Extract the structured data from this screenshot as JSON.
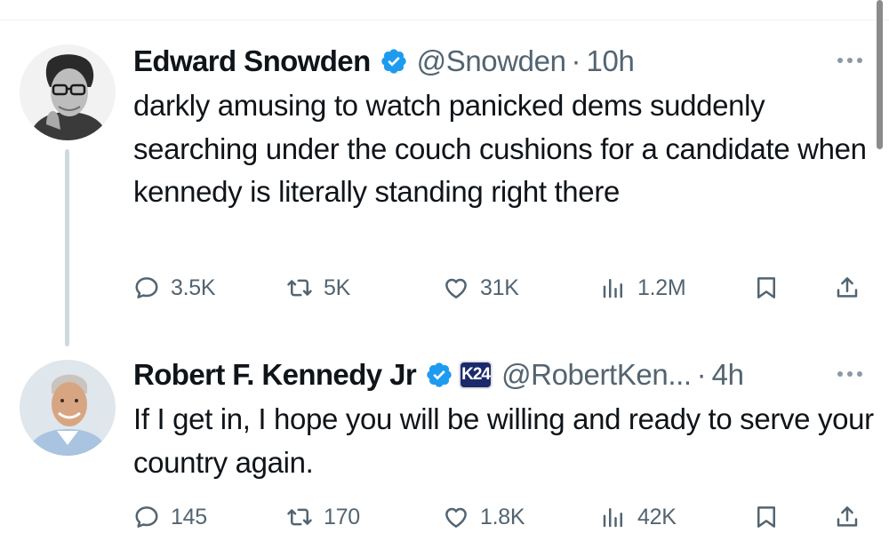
{
  "tweets": [
    {
      "name": "Edward Snowden",
      "handle": "@Snowden",
      "time": "10h",
      "text": "darkly amusing to watch panicked dems suddenly searching under the couch cushions for a candidate when kennedy is literally standing right there",
      "stats": {
        "replies": "3.5K",
        "reposts": "5K",
        "likes": "31K",
        "views": "1.2M"
      }
    },
    {
      "name": "Robert F. Kennedy Jr",
      "affiliate_badge": "K24",
      "handle": "@RobertKen...",
      "time": "4h",
      "text": "If I get in, I hope you will be willing and ready to serve your country again.",
      "stats": {
        "replies": "145",
        "reposts": "170",
        "likes": "1.8K",
        "views": "42K"
      }
    }
  ],
  "separator": "·",
  "icons": [
    "verified-badge-icon",
    "more-icon",
    "reply-icon",
    "retweet-icon",
    "like-icon",
    "views-icon",
    "bookmark-icon",
    "share-icon"
  ],
  "colors": {
    "verified": "#1d9bf0",
    "text": "#0f1419",
    "secondary": "#536471",
    "thread_line": "#cfd9de",
    "affiliate_bg": "#1c2a6b",
    "affiliate_accent": "#e2342d"
  }
}
